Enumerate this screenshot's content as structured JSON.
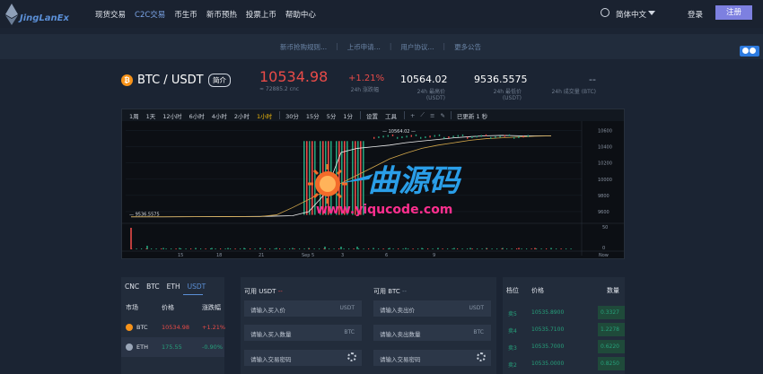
{
  "brand": {
    "name": "JingLanEx"
  },
  "nav": {
    "items": [
      "现货交易",
      "C2C交易",
      "币生币",
      "新币预热",
      "投票上币",
      "帮助中心"
    ],
    "active_index": 1,
    "language": "简体中文",
    "login": "登录",
    "register": "注册"
  },
  "notices": [
    "新币抢购规则...",
    "上币申请...",
    "用户协议...",
    "更多公告"
  ],
  "ticker": {
    "coin_symbol": "₿",
    "pair": "BTC / USDT",
    "intro_label": "简介",
    "last_price": "10534.98",
    "last_price_sub": "≈ 72885.2 cnc",
    "change": "+1.21%",
    "change_label": "24h 涨跌幅",
    "high": "10564.02",
    "high_label": "24h 最高价 (USDT)",
    "low": "9536.5575",
    "low_label": "24h 最低价 (USDT)",
    "volume": "--",
    "volume_label": "24h 成交量 (BTC)"
  },
  "chart_toolbar": {
    "periods": [
      "1周",
      "1天",
      "12小时",
      "6小时",
      "4小时",
      "2小时",
      "1小时",
      "30分",
      "15分",
      "5分",
      "1分"
    ],
    "active_period": "1小时",
    "settings_label": "设置",
    "tools_label": "工具",
    "status": "已更新 1 秒"
  },
  "chart_data": {
    "type": "line",
    "x_tick_labels": [
      "15",
      "18",
      "21",
      "Sep 5",
      "3",
      "6",
      "9"
    ],
    "y_tick_labels": [
      "10600",
      "10400",
      "10200",
      "10000",
      "9800",
      "9600"
    ],
    "volume_tick_labels": [
      "50",
      "0"
    ],
    "last_label": "Now",
    "annotations": {
      "high": "10564.02",
      "low": "9536.5575"
    },
    "series": [
      {
        "values": [
          9536,
          9536,
          9536,
          9537,
          9537,
          9538,
          9540,
          9540,
          9541,
          9545,
          9550,
          9600,
          9820,
          10330,
          10380,
          10400,
          10420,
          10450,
          10470,
          10490,
          10510,
          10525,
          10535,
          10540,
          10535,
          10534,
          10534
        ]
      },
      {
        "values": [
          9536,
          9536,
          9536,
          9536,
          9537,
          9537,
          9538,
          9539,
          9540,
          9560,
          9650,
          9750,
          9850,
          9950,
          10050,
          10150,
          10250,
          10320,
          10380,
          10420,
          10450,
          10480,
          10500,
          10510,
          10520,
          10530,
          10534
        ]
      }
    ],
    "colors": {
      "price": "#f0f0f0",
      "ma": "#d4a84b",
      "up": "#26a17b",
      "down": "#e94b48"
    }
  },
  "market": {
    "tabs": [
      "CNC",
      "BTC",
      "ETH",
      "USDT"
    ],
    "active_tab": "USDT",
    "headers": [
      "市场",
      "价格",
      "涨跌幅"
    ],
    "rows": [
      {
        "name": "BTC",
        "price": "10534.98",
        "change": "+1.21%",
        "icon_color": "#f7931a",
        "price_color": "#e94b48",
        "change_color": "#e94b48"
      },
      {
        "name": "ETH",
        "price": "175.55",
        "change": "-0.90%",
        "icon_color": "#9aa6b8",
        "price_color": "#26a17b",
        "change_color": "#26a17b"
      }
    ]
  },
  "trade": {
    "buy_avail_label": "可用 USDT",
    "buy_avail_value": "--",
    "sell_avail_label": "可用 BTC",
    "sell_avail_value": "--",
    "buy_price_ph": "请输入买入价",
    "buy_amount_ph": "请输入买入数量",
    "buy_pwd_ph": "请输入交易密码",
    "sell_price_ph": "请输入卖出价",
    "sell_amount_ph": "请输入卖出数量",
    "sell_pwd_ph": "请输入交易密码",
    "unit_usdt": "USDT",
    "unit_btc": "BTC"
  },
  "orderbook": {
    "headers": [
      "档位",
      "价格",
      "数量"
    ],
    "rows": [
      {
        "level": "卖5",
        "price": "10535.8900",
        "qty": "0.3327",
        "depth": 0.22
      },
      {
        "level": "卖4",
        "price": "10535.7100",
        "qty": "1.2278",
        "depth": 0.22
      },
      {
        "level": "卖3",
        "price": "10535.7000",
        "qty": "0.6220",
        "depth": 0.22
      },
      {
        "level": "卖2",
        "price": "10535.0000",
        "qty": "0.8250",
        "depth": 0.22
      }
    ]
  },
  "watermark": {
    "title": "曲源码",
    "url": "www.yiqucode.com"
  }
}
